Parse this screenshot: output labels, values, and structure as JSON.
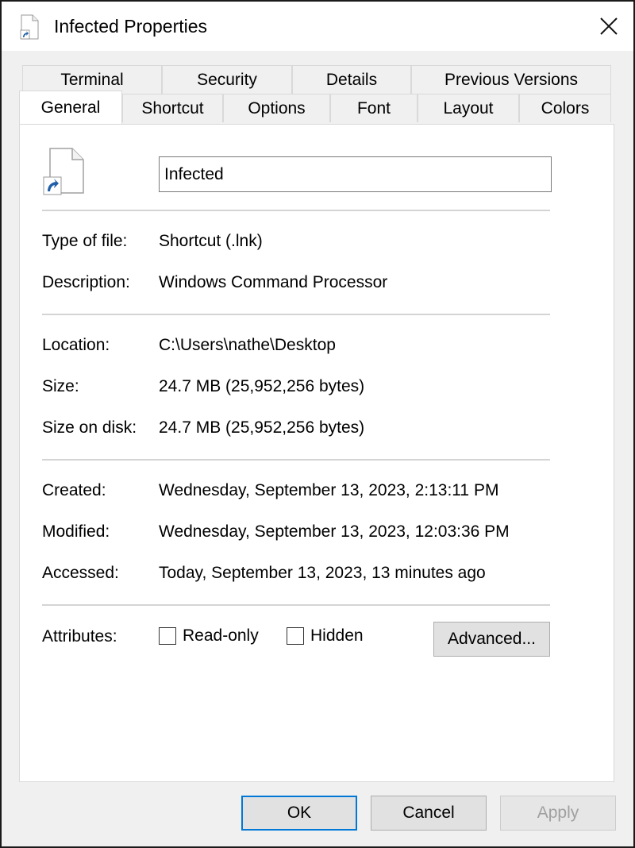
{
  "window": {
    "title": "Infected Properties",
    "close_label": "✕"
  },
  "tabs": {
    "row_back": [
      "Terminal",
      "Security",
      "Details",
      "Previous Versions"
    ],
    "row_front": [
      "General",
      "Shortcut",
      "Options",
      "Font",
      "Layout",
      "Colors"
    ],
    "active": "General"
  },
  "general": {
    "name_value": "Infected",
    "type_label": "Type of file:",
    "type_value": "Shortcut (.lnk)",
    "description_label": "Description:",
    "description_value": "Windows Command Processor",
    "location_label": "Location:",
    "location_value": "C:\\Users\\nathe\\Desktop",
    "size_label": "Size:",
    "size_value": "24.7 MB (25,952,256 bytes)",
    "size_on_disk_label": "Size on disk:",
    "size_on_disk_value": "24.7 MB (25,952,256 bytes)",
    "created_label": "Created:",
    "created_value": "Wednesday, September 13, 2023, 2:13:11 PM",
    "modified_label": "Modified:",
    "modified_value": "Wednesday, September 13, 2023, 12:03:36 PM",
    "accessed_label": "Accessed:",
    "accessed_value": "Today, September 13, 2023, 13 minutes ago",
    "attributes_label": "Attributes:",
    "readonly_label": "Read-only",
    "hidden_label": "Hidden",
    "advanced_label": "Advanced..."
  },
  "footer": {
    "ok_label": "OK",
    "cancel_label": "Cancel",
    "apply_label": "Apply"
  },
  "colors": {
    "accent": "#0078d7",
    "window_bg": "#f0f0f0",
    "panel_bg": "#ffffff"
  },
  "icons": [
    "shortcut-file-icon",
    "close-icon",
    "checkbox-icon"
  ]
}
